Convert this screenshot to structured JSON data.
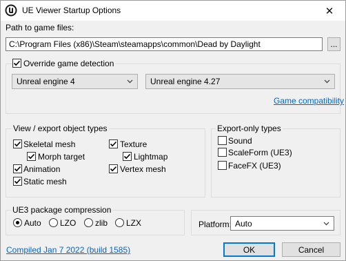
{
  "window": {
    "title": "UE Viewer Startup Options",
    "close_glyph": "✕"
  },
  "game_path": {
    "label": "Path to game files:",
    "value": "C:\\Program Files (x86)\\Steam\\steamapps\\common\\Dead by Daylight",
    "browse_label": "..."
  },
  "override": {
    "label": "Override game detection",
    "checked": true,
    "engine_select": "Unreal engine 4",
    "version_select": "Unreal engine 4.27",
    "compat_link": "Game compatibility"
  },
  "view_export": {
    "title": "View / export object types",
    "skeletal_mesh": "Skeletal mesh",
    "morph_target": "Morph target",
    "animation": "Animation",
    "static_mesh": "Static mesh",
    "texture": "Texture",
    "lightmap": "Lightmap",
    "vertex_mesh": "Vertex mesh"
  },
  "export_only": {
    "title": "Export-only types",
    "sound": "Sound",
    "scaleform": "ScaleForm (UE3)",
    "facefx": "FaceFX (UE3)"
  },
  "compression": {
    "title": "UE3 package compression",
    "auto": "Auto",
    "lzo": "LZO",
    "zlib": "zlib",
    "lzx": "LZX"
  },
  "platform": {
    "label": "Platform:",
    "value": "Auto"
  },
  "footer": {
    "compiled_link": "Compiled Jan  7 2022 (build 1585)",
    "ok_label": "OK",
    "cancel_label": "Cancel"
  },
  "colors": {
    "accent": "#0078d7",
    "link": "#0066cc"
  }
}
